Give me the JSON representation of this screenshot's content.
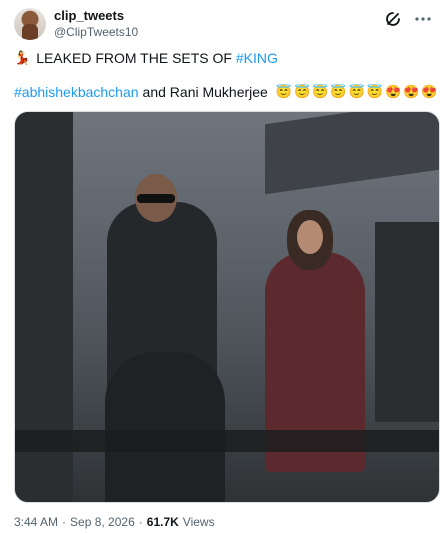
{
  "author": {
    "display_name": "clip_tweets",
    "handle": "@ClipTweets10"
  },
  "icons": {
    "grok": "grok-icon",
    "more": "more-icon"
  },
  "tweet": {
    "line1_emoji": "💃",
    "line1_text": "LEAKED FROM THE SETS OF ",
    "line1_link": "#KING",
    "line2_link": "#abhishekbachchan",
    "line2_text": " and Rani Mukherjee",
    "emojis": [
      "😇",
      "😇",
      "😇",
      "😇",
      "😇",
      "😇",
      "😍",
      "😍",
      "😍"
    ]
  },
  "media": {
    "alt": "Photo from film set showing a man in dark suit and sunglasses and a woman in a maroon saree"
  },
  "meta": {
    "time": "3:44 AM",
    "dot1": "·",
    "date": "Sep 8, 2026",
    "dot2": "·",
    "views_count": "61.7K",
    "views_label": "Views"
  },
  "colors": {
    "link": "#1d9bf0",
    "secondary_text": "#536471"
  }
}
